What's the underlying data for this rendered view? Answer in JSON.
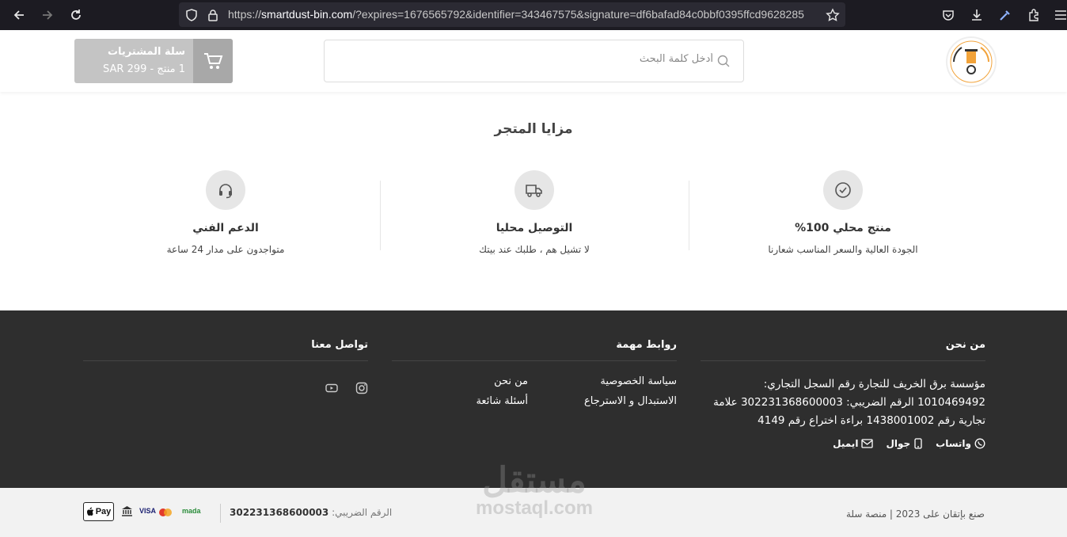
{
  "browser": {
    "url_prefix": "https://",
    "url_host": "smartdust-bin.com",
    "url_rest": "/?expires=1676565792&identifier=343467575&signature=df6bafad84c0bbf0395ffcd9628285"
  },
  "header": {
    "search_placeholder": "أدخل كلمة البحث",
    "cart_title": "سلة المشتريات",
    "cart_summary": "1 منتج - 299 SAR"
  },
  "features": {
    "title": "مزايا المتجر",
    "items": [
      {
        "icon": "check-circle-icon",
        "title": "منتج محلي 100%",
        "desc": "الجودة العالية والسعر المناسب شعارنا"
      },
      {
        "icon": "truck-icon",
        "title": "التوصيل محليا",
        "desc": "لا تشيل هم ، طلبك عند بيتك"
      },
      {
        "icon": "headset-icon",
        "title": "الدعم الفني",
        "desc": "متواجدون على مدار 24 ساعة"
      }
    ]
  },
  "footer": {
    "about": {
      "title": "من نحن",
      "text": "مؤسسة برق الخريف للتجارة رقم السجل التجاري: 1010469492 الرقم الضريبي: 302231368600003 علامة تجارية رقم 1438001002 براءة اختراع رقم 4149",
      "whatsapp": "واتساب",
      "phone": "جوال",
      "email": "ايميل"
    },
    "links": {
      "title": "روابط مهمة",
      "items": [
        "سياسة الخصوصية",
        "من نحن",
        "الاستبدال و الاسترجاع",
        "أسئلة شائعة"
      ]
    },
    "contact": {
      "title": "تواصل معنا"
    }
  },
  "bottom": {
    "credits": "صنع بإتقان على   2023  |  منصة سلة",
    "tax_label": "الرقم الضريبي:",
    "tax_number": "302231368600003",
    "pay_mada": "mada",
    "pay_visa": "VISA",
    "pay_apple": "Pay"
  },
  "watermark": {
    "ar": "مستقل",
    "en": "mostaql.com"
  }
}
